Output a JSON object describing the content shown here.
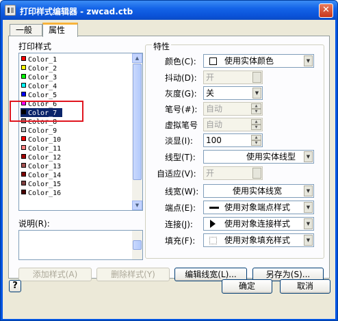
{
  "window": {
    "title": "打印样式编辑器 - zwcad.ctb"
  },
  "tabs": [
    {
      "label": "一般"
    },
    {
      "label": "属性"
    }
  ],
  "styles_panel": {
    "label": "打印样式",
    "items": [
      {
        "label": "Color_1",
        "color": "#ff0000"
      },
      {
        "label": "Color_2",
        "color": "#ffff00"
      },
      {
        "label": "Color_3",
        "color": "#00ff00"
      },
      {
        "label": "Color_4",
        "color": "#00ffff"
      },
      {
        "label": "Color_5",
        "color": "#0000ff"
      },
      {
        "label": "Color_6",
        "color": "#ff00ff"
      },
      {
        "label": "Color_7",
        "color": "#000000",
        "selected": true
      },
      {
        "label": "Color_8",
        "color": "#808080"
      },
      {
        "label": "Color_9",
        "color": "#c0c0c0"
      },
      {
        "label": "Color_10",
        "color": "#ff0000"
      },
      {
        "label": "Color_11",
        "color": "#ff7f7f"
      },
      {
        "label": "Color_12",
        "color": "#a50000"
      },
      {
        "label": "Color_13",
        "color": "#a55252"
      },
      {
        "label": "Color_14",
        "color": "#7f0000"
      },
      {
        "label": "Color_15",
        "color": "#7f3f3f"
      },
      {
        "label": "Color_16",
        "color": "#4c0000"
      }
    ]
  },
  "description": {
    "label": "说明(R):",
    "value": ""
  },
  "properties": {
    "label": "特性",
    "color": {
      "label": "颜色(C):",
      "value": "使用实体颜色"
    },
    "dither": {
      "label": "抖动(D):",
      "value": "开"
    },
    "grayscale": {
      "label": "灰度(G):",
      "value": "关"
    },
    "pen": {
      "label": "笔号(#):",
      "value": "自动"
    },
    "virtual_pen": {
      "label": "虚拟笔号",
      "value": "自动"
    },
    "screening": {
      "label": "淡显(I):",
      "value": "100"
    },
    "linetype": {
      "label": "线型(T):",
      "value": "使用实体线型"
    },
    "adaptive": {
      "label": "自适应(V):",
      "value": "开"
    },
    "lineweight": {
      "label": "线宽(W):",
      "value": "使用实体线宽"
    },
    "line_end": {
      "label": "端点(E):",
      "value": "使用对象端点样式"
    },
    "line_join": {
      "label": "连接(J):",
      "value": "使用对象连接样式"
    },
    "fill": {
      "label": "填充(F):",
      "value": "使用对象填充样式"
    }
  },
  "buttons": {
    "add_style": "添加样式(A)",
    "delete_style": "删除样式(Y)",
    "edit_lineweights": "编辑线宽(L)...",
    "save_as": "另存为(S)...",
    "help": "?",
    "ok": "确定",
    "cancel": "取消"
  },
  "colors": {
    "titlebar": "#0054e3",
    "selection": "#0a246a",
    "highlight": "#e0141e",
    "tab_accent": "#f8b33a"
  }
}
